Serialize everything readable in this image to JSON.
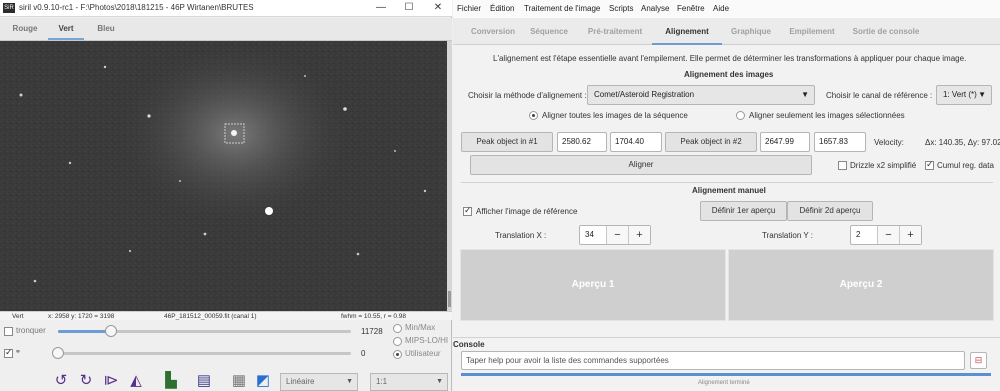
{
  "left_window": {
    "title": "siril v0.9.10-rc1 - F:\\Photos\\2018\\181215 - 46P Wirtanen\\BRUTES",
    "app_icon_text": "SiR",
    "window_buttons": [
      "—",
      "☐",
      "✕"
    ],
    "channel_tabs": [
      "Rouge",
      "Vert",
      "Bleu"
    ],
    "status": {
      "channel": "Vert",
      "coords": "x: 2958 y: 1720 = 3198",
      "filename": "46P_181512_00059.fit (canal 1)",
      "fwhm": "fwhm = 10.55, r = 0.98"
    },
    "tronquer_label": "tronquer",
    "max_value": "11728",
    "min_value": "0",
    "max_slider_level": 0.18,
    "min_slider_level": 0.0,
    "range_options": [
      "Min/Max",
      "MIPS-LO/HI",
      "Utilisateur"
    ],
    "scale_combo": "Linéaire",
    "zoom_combo": "1:1",
    "tool_icons": [
      "rotate-left-icon",
      "rotate-right-icon",
      "flip-horizontal-icon",
      "flip-vertical-icon",
      "histogram-icon",
      "info-icon",
      "photometry-icon",
      "colormap-icon"
    ]
  },
  "right_window": {
    "menu": [
      "Fichier",
      "Édition",
      "Traitement de l'image",
      "Scripts",
      "Analyse",
      "Fenêtre",
      "Aide"
    ],
    "tabs": [
      "Conversion",
      "Séquence",
      "Pré-traitement",
      "Alignement",
      "Graphique",
      "Empilement",
      "Sortie de console"
    ],
    "active_tab": "Alignement",
    "intro": "L'alignement est l'étape essentielle avant l'empilement. Elle permet de déterminer les transformations à appliquer pour chaque image.",
    "align_section": "Alignement des images",
    "method_label": "Choisir la méthode d'alignement :",
    "method_value": "Comet/Asteroid Registration",
    "channel_label": "Choisir le canal de référence :",
    "channel_value": "1: Vert (*)",
    "radio_all": "Aligner toutes les images de la séquence",
    "radio_selected": "Aligner seulement les images sélectionnées",
    "peak1_button": "Peak object in #1",
    "peak1_x": "2580.62",
    "peak1_y": "1704.40",
    "peak2_button": "Peak object in #2",
    "peak2_x": "2647.99",
    "peak2_y": "1657.83",
    "velocity_label": "Velocity:",
    "velocity_value": "Δx: 140.35, Δy: 97.02",
    "align_button": "Aligner",
    "drizzle_label": "Drizzle x2 simplifié",
    "cumul_label": "Cumul reg. data",
    "manual_section": "Alignement manuel",
    "show_ref_label": "Afficher l'image de référence",
    "def1_button": "Définir 1er aperçu",
    "def2_button": "Définir 2d aperçu",
    "trans_x_label": "Translation X :",
    "trans_x_value": "34",
    "trans_y_label": "Translation Y :",
    "trans_y_value": "2",
    "preview1": "Aperçu 1",
    "preview2": "Aperçu 2",
    "console_label": "Console",
    "console_placeholder": "Taper help pour avoir la liste des commandes supportées",
    "status_text": "Alignement terminé"
  },
  "colors": {
    "accent": "#6f9bd4",
    "viewport_bg": "#3a3a3a",
    "icon_purple": "#5a2e8c"
  }
}
